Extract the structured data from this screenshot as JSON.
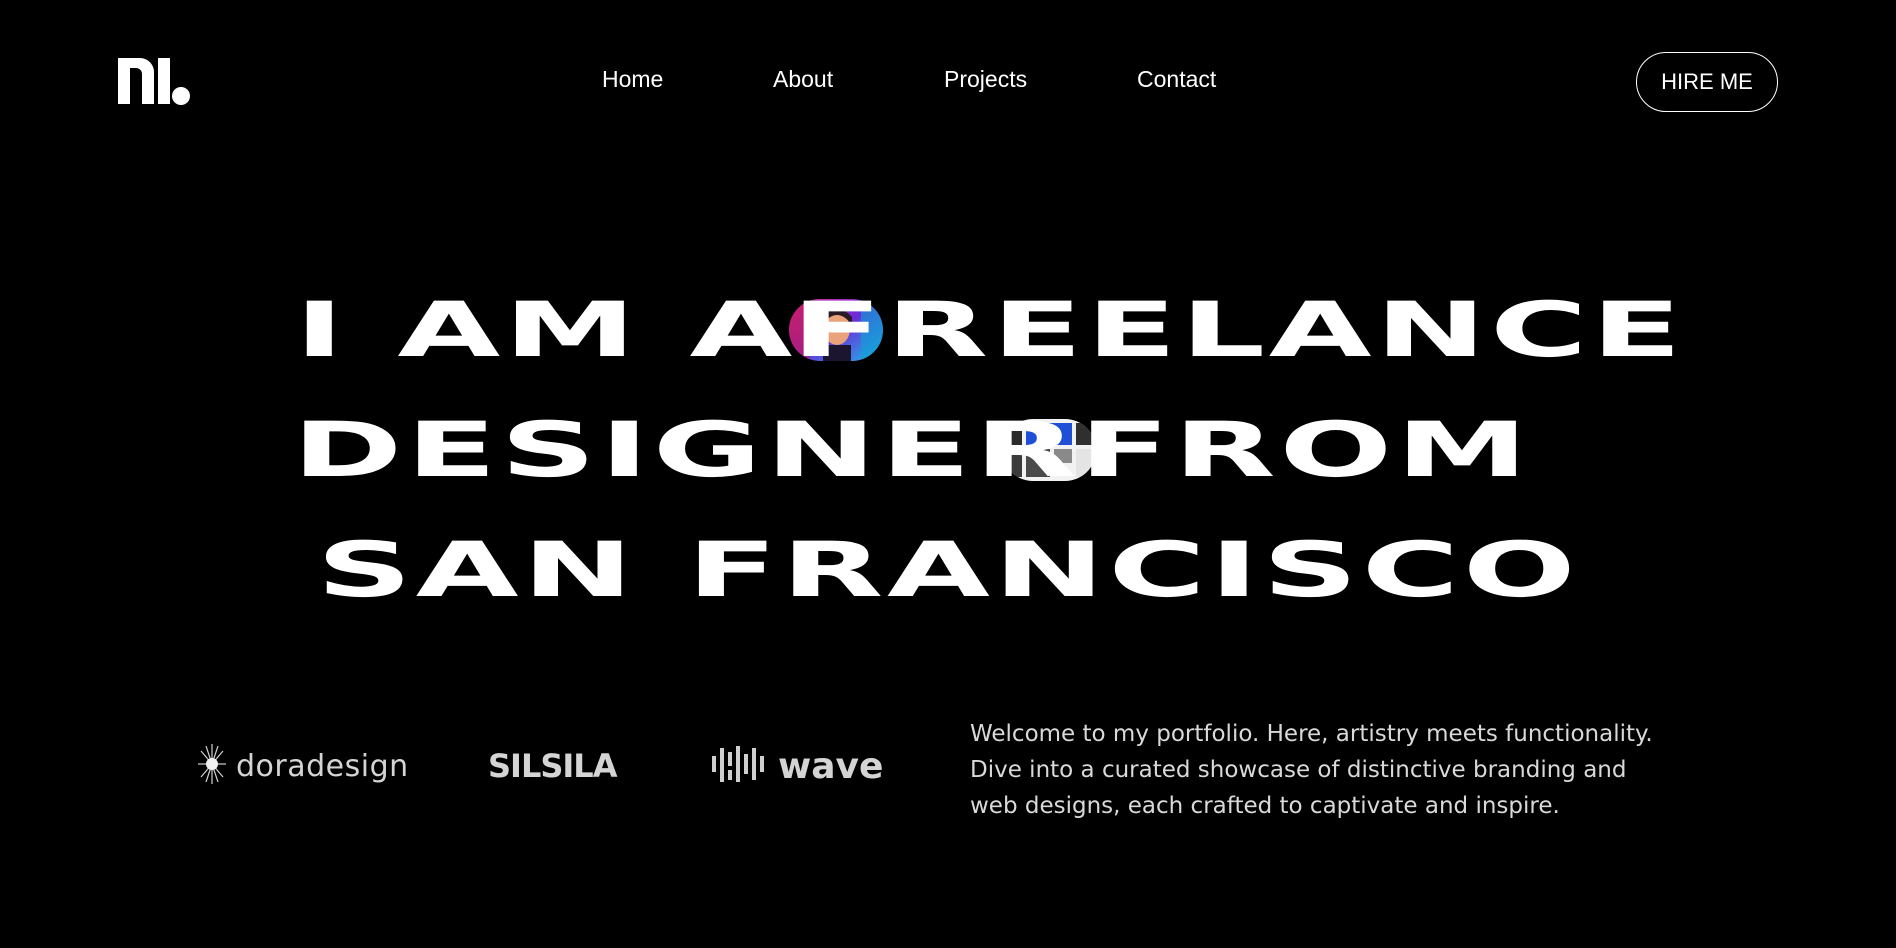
{
  "header": {
    "logo_name": "logo-icon",
    "nav": [
      {
        "label": "Home"
      },
      {
        "label": "About"
      },
      {
        "label": "Projects"
      },
      {
        "label": "Contact"
      }
    ],
    "cta_label": "HIRE ME"
  },
  "hero": {
    "line1": {
      "before": "I AM A",
      "after": "FREELANCE"
    },
    "line2": {
      "before": "DESIGNER",
      "after": "FROM"
    },
    "line3": "SAN FRANCISCO"
  },
  "brands": {
    "items": [
      {
        "label": "doradesign",
        "icon": "sunburst-icon"
      },
      {
        "label": "SILSILA"
      },
      {
        "label": "wave",
        "icon": "wave-bars-icon"
      }
    ]
  },
  "intro": {
    "lines": [
      "Welcome to my portfolio. Here, artistry meets functionality.",
      "Dive into a curated showcase of distinctive branding and",
      "web designs, each crafted to captivate and inspire."
    ]
  },
  "colors": {
    "background": "#000000",
    "text": "#ffffff",
    "muted_text": "#d9d9d9"
  }
}
